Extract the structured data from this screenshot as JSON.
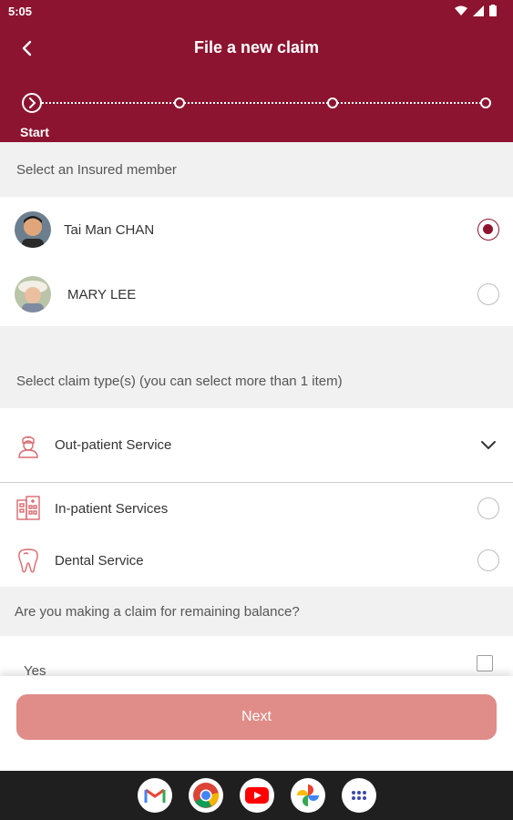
{
  "status_bar": {
    "time": "5:05"
  },
  "header": {
    "title": "File a new claim",
    "step_label": "Start"
  },
  "insured": {
    "section_title": "Select an Insured member",
    "members": [
      {
        "name": "Tai Man CHAN",
        "selected": true
      },
      {
        "name": "MARY LEE",
        "selected": false
      }
    ]
  },
  "claim_types": {
    "section_title": "Select claim type(s) (you can select more than 1 item)",
    "items": [
      {
        "label": "Out-patient Service",
        "icon": "doctor-icon",
        "control": "chevron-down"
      },
      {
        "label": "In-patient Services",
        "icon": "hospital-icon",
        "control": "radio"
      },
      {
        "label": "Dental Service",
        "icon": "tooth-icon",
        "control": "radio"
      }
    ]
  },
  "remaining_balance": {
    "question": "Are you making a claim for remaining balance?",
    "option_label": "Yes"
  },
  "footer": {
    "next_label": "Next"
  },
  "colors": {
    "brand": "#8c1430",
    "next_disabled": "#e08c88",
    "section_bg": "#f1f1f1"
  },
  "nav_apps": [
    "gmail-icon",
    "chrome-icon",
    "youtube-icon",
    "photos-icon",
    "app-drawer-icon"
  ]
}
